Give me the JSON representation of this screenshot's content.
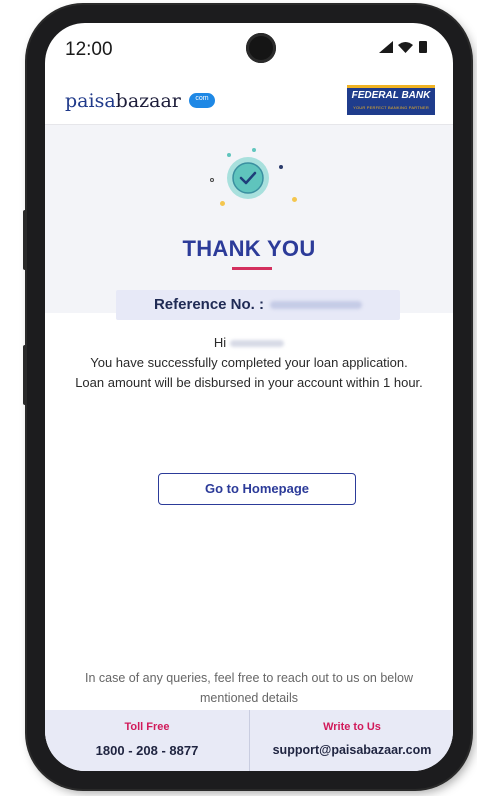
{
  "status_bar": {
    "time": "12:00",
    "icons": [
      "signal-icon",
      "wifi-icon",
      "battery-icon"
    ]
  },
  "header": {
    "logo_part1": "paisa",
    "logo_part2": "bazaar",
    "logo_badge": "com",
    "bank_name": "FEDERAL BANK",
    "bank_tagline": "YOUR PERFECT BANKING PARTNER"
  },
  "hero": {
    "title": "THANK YOU",
    "accent_color": "#d32f5e"
  },
  "reference": {
    "label": "Reference No. :"
  },
  "message": {
    "greeting": "Hi",
    "line1": "You have successfully completed your loan application.",
    "line2": "Loan amount will be disbursed in your account within 1 hour."
  },
  "actions": {
    "home_label": "Go to Homepage"
  },
  "footer": {
    "query_text": "In case of any queries, feel free to reach out to us on below mentioned details",
    "toll_free_title": "Toll Free",
    "toll_free_value": "1800 - 208 - 8877",
    "write_title": "Write to Us",
    "write_value": "support@paisabazaar.com"
  },
  "colors": {
    "brand_blue": "#2c3b99",
    "accent_pink": "#d11a5a"
  }
}
